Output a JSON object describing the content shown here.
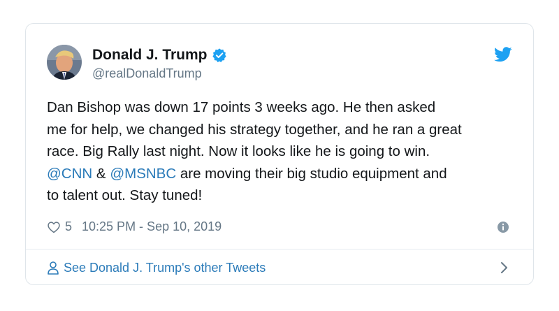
{
  "tweet": {
    "author": {
      "display_name": "Donald J. Trump",
      "handle": "@realDonaldTrump",
      "verified": true
    },
    "text": {
      "line1": "Dan Bishop was down 17 points 3 weeks ago. He then asked",
      "line2": "me for help, we changed his strategy together, and he ran a great",
      "line3": "race. Big Rally last night. Now it looks like he is going to win.",
      "mention1": "@CNN",
      "amp": " & ",
      "mention2": "@MSNBC",
      "line4_rest": " are moving their big studio equipment and",
      "line5": "to talent out. Stay tuned!"
    },
    "likes": "5",
    "timestamp": "10:25 PM - Sep 10, 2019",
    "footer_link": "See Donald J. Trump's other Tweets"
  },
  "icons": {
    "verified": "verified-badge-icon",
    "bird": "twitter-bird-icon",
    "heart": "heart-icon",
    "info": "info-icon",
    "person": "person-icon",
    "chevron": "chevron-right-icon"
  },
  "colors": {
    "brand_blue": "#1da1f2",
    "link_blue": "#2b7bb9",
    "text": "#14171a",
    "muted": "#657786",
    "border": "#dfe5ea"
  }
}
